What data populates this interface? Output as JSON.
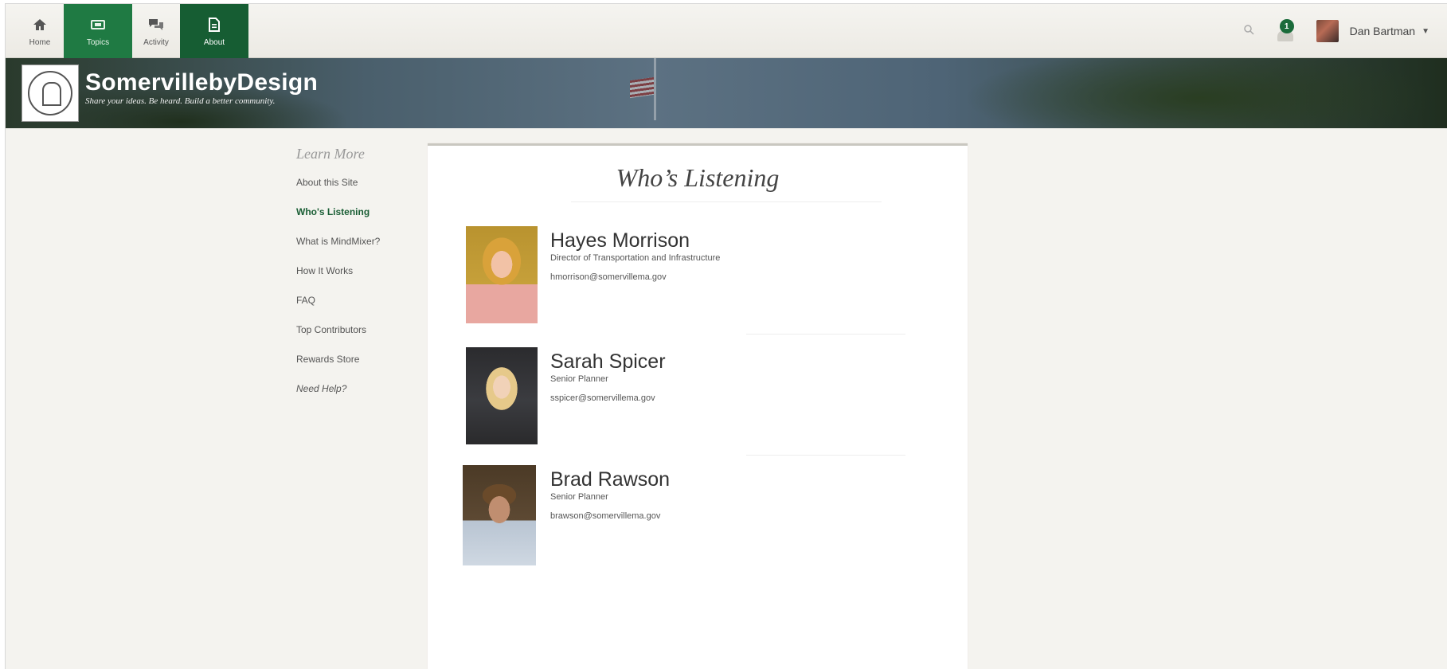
{
  "nav": {
    "tabs": [
      {
        "label": "Home",
        "icon": "home-icon"
      },
      {
        "label": "Topics",
        "icon": "topics-icon"
      },
      {
        "label": "Activity",
        "icon": "activity-icon"
      },
      {
        "label": "About",
        "icon": "about-icon"
      }
    ],
    "notifications_count": "1",
    "user_name": "Dan Bartman",
    "search_icon": "search-icon",
    "bell_icon": "bell-icon"
  },
  "banner": {
    "title": "SomervillebyDesign",
    "tagline": "Share your ideas. Be heard. Build a better community."
  },
  "sidebar": {
    "heading": "Learn More",
    "items": [
      {
        "label": "About this Site"
      },
      {
        "label": "Who's Listening"
      },
      {
        "label": "What is MindMixer?"
      },
      {
        "label": "How It Works"
      },
      {
        "label": "FAQ"
      },
      {
        "label": "Top Contributors"
      },
      {
        "label": "Rewards Store"
      },
      {
        "label": "Need Help?"
      }
    ]
  },
  "main": {
    "title": "Who’s Listening",
    "people": [
      {
        "name": "Hayes Morrison",
        "title": "Director of Transportation and Infrastructure",
        "email": "hmorrison@somervillema.gov"
      },
      {
        "name": "Sarah Spicer",
        "title": "Senior Planner",
        "email": "sspicer@somervillema.gov"
      },
      {
        "name": "Brad Rawson",
        "title": "Senior Planner",
        "email": "brawson@somervillema.gov"
      }
    ]
  },
  "colors": {
    "brand_green": "#1f7a43",
    "brand_dark_green": "#165d33",
    "active_link": "#1a5e35"
  }
}
